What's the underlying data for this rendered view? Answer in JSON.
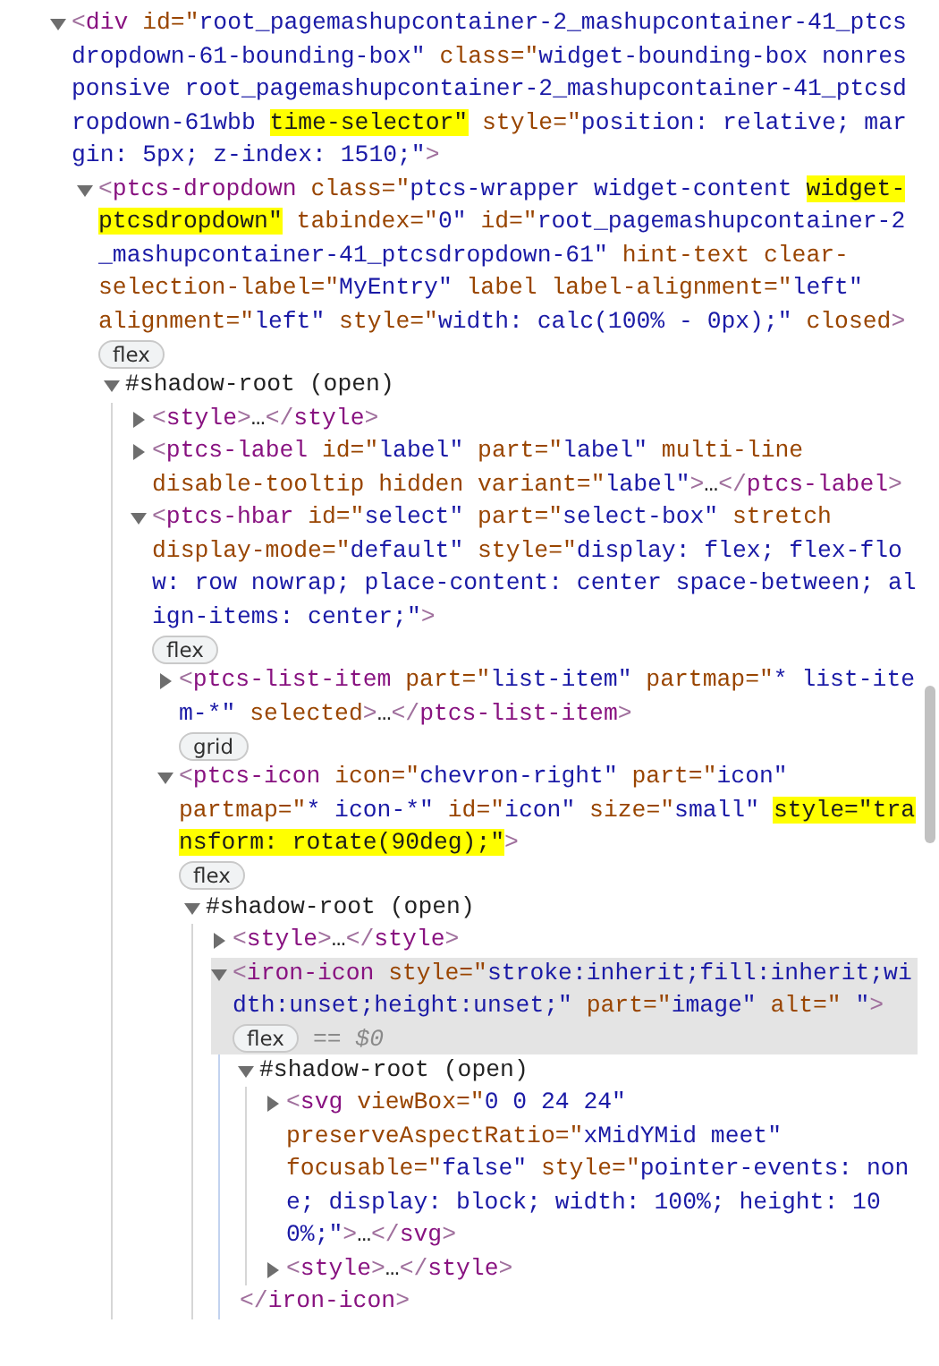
{
  "nodes": [
    {
      "kind": "element",
      "expanded": true,
      "selected": false,
      "parts": [
        {
          "kind": "punct",
          "text": "<"
        },
        {
          "kind": "tag",
          "text": "div"
        },
        {
          "kind": "attr",
          "text": " id=\""
        },
        {
          "kind": "value",
          "text": "root_pagemashupcontainer-2_mashupcontainer-41_ptcsdropdown-61-bounding-box\""
        },
        {
          "kind": "attr",
          "text": " class=\""
        },
        {
          "kind": "value",
          "text": "widget-bounding-box nonresponsive root_pagemashupcontainer-2_mashupcontainer-41_ptcsdropdown-61wbb "
        },
        {
          "kind": "mark",
          "text": "time-selector\""
        },
        {
          "kind": "attr",
          "text": " style=\""
        },
        {
          "kind": "value",
          "text": "position: relative; margin: 5px; z-index: 1510;\""
        },
        {
          "kind": "punct",
          "text": ">"
        }
      ],
      "children": [
        {
          "kind": "element",
          "expanded": true,
          "selected": false,
          "badge": "flex",
          "parts": [
            {
              "kind": "punct",
              "text": "<"
            },
            {
              "kind": "tag",
              "text": "ptcs-dropdown"
            },
            {
              "kind": "attr",
              "text": " class=\""
            },
            {
              "kind": "value",
              "text": "ptcs-wrapper widget-content "
            },
            {
              "kind": "mark",
              "text": "widget-ptcsdropdown\""
            },
            {
              "kind": "attr",
              "text": " tabindex=\""
            },
            {
              "kind": "value",
              "text": "0\""
            },
            {
              "kind": "attr",
              "text": " id=\""
            },
            {
              "kind": "value",
              "text": "root_pagemashupcontainer-2_mashupcontainer-41_ptcsdropdown-61\""
            },
            {
              "kind": "attr",
              "text": " hint-text clear-selection-label=\""
            },
            {
              "kind": "value",
              "text": "MyEntry\""
            },
            {
              "kind": "attr",
              "text": " label label-alignment=\""
            },
            {
              "kind": "value",
              "text": "left\""
            },
            {
              "kind": "attr",
              "text": " alignment=\""
            },
            {
              "kind": "value",
              "text": "left\""
            },
            {
              "kind": "attr",
              "text": " style=\""
            },
            {
              "kind": "value",
              "text": "width: calc(100% - 0px);\""
            },
            {
              "kind": "attr",
              "text": " closed"
            },
            {
              "kind": "punct",
              "text": ">"
            }
          ],
          "children": [
            {
              "kind": "shadow-root",
              "expanded": true,
              "selected": false,
              "parts": [
                {
                  "kind": "text",
                  "text": "#shadow-root (open)"
                }
              ],
              "children": [
                {
                  "kind": "element",
                  "expanded": false,
                  "selected": false,
                  "parts": [
                    {
                      "kind": "punct",
                      "text": "<"
                    },
                    {
                      "kind": "tag",
                      "text": "style"
                    },
                    {
                      "kind": "punct",
                      "text": ">"
                    },
                    {
                      "kind": "text",
                      "text": "…"
                    },
                    {
                      "kind": "punct",
                      "text": "</"
                    },
                    {
                      "kind": "tag",
                      "text": "style"
                    },
                    {
                      "kind": "punct",
                      "text": ">"
                    }
                  ]
                },
                {
                  "kind": "element",
                  "expanded": false,
                  "selected": false,
                  "parts": [
                    {
                      "kind": "punct",
                      "text": "<"
                    },
                    {
                      "kind": "tag",
                      "text": "ptcs-label"
                    },
                    {
                      "kind": "attr",
                      "text": " id=\""
                    },
                    {
                      "kind": "value",
                      "text": "label\""
                    },
                    {
                      "kind": "attr",
                      "text": " part=\""
                    },
                    {
                      "kind": "value",
                      "text": "label\""
                    },
                    {
                      "kind": "attr",
                      "text": " multi-line disable-tooltip hidden variant=\""
                    },
                    {
                      "kind": "value",
                      "text": "label\""
                    },
                    {
                      "kind": "punct",
                      "text": ">"
                    },
                    {
                      "kind": "text",
                      "text": "…"
                    },
                    {
                      "kind": "punct",
                      "text": "</"
                    },
                    {
                      "kind": "tag",
                      "text": "ptcs-label"
                    },
                    {
                      "kind": "punct",
                      "text": ">"
                    }
                  ]
                },
                {
                  "kind": "element",
                  "expanded": true,
                  "selected": false,
                  "badge": "flex",
                  "parts": [
                    {
                      "kind": "punct",
                      "text": "<"
                    },
                    {
                      "kind": "tag",
                      "text": "ptcs-hbar"
                    },
                    {
                      "kind": "attr",
                      "text": " id=\""
                    },
                    {
                      "kind": "value",
                      "text": "select\""
                    },
                    {
                      "kind": "attr",
                      "text": " part=\""
                    },
                    {
                      "kind": "value",
                      "text": "select-box\""
                    },
                    {
                      "kind": "attr",
                      "text": " stretch display-mode=\""
                    },
                    {
                      "kind": "value",
                      "text": "default\""
                    },
                    {
                      "kind": "attr",
                      "text": " style=\""
                    },
                    {
                      "kind": "value",
                      "text": "display: flex; flex-flow: row nowrap; place-content: center space-between; align-items: center;\""
                    },
                    {
                      "kind": "punct",
                      "text": ">"
                    }
                  ],
                  "children": [
                    {
                      "kind": "element",
                      "expanded": false,
                      "selected": false,
                      "badge": "grid",
                      "parts": [
                        {
                          "kind": "punct",
                          "text": "<"
                        },
                        {
                          "kind": "tag",
                          "text": "ptcs-list-item"
                        },
                        {
                          "kind": "attr",
                          "text": " part=\""
                        },
                        {
                          "kind": "value",
                          "text": "list-item\""
                        },
                        {
                          "kind": "attr",
                          "text": " partmap=\""
                        },
                        {
                          "kind": "value",
                          "text": "* list-item-*\""
                        },
                        {
                          "kind": "attr",
                          "text": " selected"
                        },
                        {
                          "kind": "punct",
                          "text": ">"
                        },
                        {
                          "kind": "text",
                          "text": "…"
                        },
                        {
                          "kind": "punct",
                          "text": "</"
                        },
                        {
                          "kind": "tag",
                          "text": "ptcs-list-item"
                        },
                        {
                          "kind": "punct",
                          "text": ">"
                        }
                      ]
                    },
                    {
                      "kind": "element",
                      "expanded": true,
                      "selected": false,
                      "badge": "flex",
                      "parts": [
                        {
                          "kind": "punct",
                          "text": "<"
                        },
                        {
                          "kind": "tag",
                          "text": "ptcs-icon"
                        },
                        {
                          "kind": "attr",
                          "text": " icon=\""
                        },
                        {
                          "kind": "value",
                          "text": "chevron-right\""
                        },
                        {
                          "kind": "attr",
                          "text": " part=\""
                        },
                        {
                          "kind": "value",
                          "text": "icon\""
                        },
                        {
                          "kind": "attr",
                          "text": " partmap=\""
                        },
                        {
                          "kind": "value",
                          "text": "* icon-*\""
                        },
                        {
                          "kind": "attr",
                          "text": " id=\""
                        },
                        {
                          "kind": "value",
                          "text": "icon\""
                        },
                        {
                          "kind": "attr",
                          "text": " size=\""
                        },
                        {
                          "kind": "value",
                          "text": "small\" "
                        },
                        {
                          "kind": "mark",
                          "text": "style=\"transform: rotate(90deg);\""
                        },
                        {
                          "kind": "punct",
                          "text": ">"
                        }
                      ],
                      "children": [
                        {
                          "kind": "shadow-root",
                          "expanded": true,
                          "selected": false,
                          "parts": [
                            {
                              "kind": "text",
                              "text": "#shadow-root (open)"
                            }
                          ],
                          "children": [
                            {
                              "kind": "element",
                              "expanded": false,
                              "selected": false,
                              "parts": [
                                {
                                  "kind": "punct",
                                  "text": "<"
                                },
                                {
                                  "kind": "tag",
                                  "text": "style"
                                },
                                {
                                  "kind": "punct",
                                  "text": ">"
                                },
                                {
                                  "kind": "text",
                                  "text": "…"
                                },
                                {
                                  "kind": "punct",
                                  "text": "</"
                                },
                                {
                                  "kind": "tag",
                                  "text": "style"
                                },
                                {
                                  "kind": "punct",
                                  "text": ">"
                                }
                              ]
                            },
                            {
                              "kind": "element",
                              "expanded": true,
                              "selected": true,
                              "badge": "flex",
                              "console_ref": "== $0",
                              "parts": [
                                {
                                  "kind": "punct",
                                  "text": "<"
                                },
                                {
                                  "kind": "tag",
                                  "text": "iron-icon"
                                },
                                {
                                  "kind": "attr",
                                  "text": " style=\""
                                },
                                {
                                  "kind": "value",
                                  "text": "stroke:inherit;fill:inherit;width:unset;height:unset;\""
                                },
                                {
                                  "kind": "attr",
                                  "text": " part=\""
                                },
                                {
                                  "kind": "value",
                                  "text": "image\""
                                },
                                {
                                  "kind": "attr",
                                  "text": " alt=\""
                                },
                                {
                                  "kind": "value",
                                  "text": " \""
                                },
                                {
                                  "kind": "punct",
                                  "text": ">"
                                }
                              ],
                              "closing": [
                                {
                                  "kind": "punct",
                                  "text": "</"
                                },
                                {
                                  "kind": "tag",
                                  "text": "iron-icon"
                                },
                                {
                                  "kind": "punct",
                                  "text": ">"
                                }
                              ],
                              "children": [
                                {
                                  "kind": "shadow-root",
                                  "expanded": true,
                                  "selected": false,
                                  "parts": [
                                    {
                                      "kind": "text",
                                      "text": "#shadow-root (open)"
                                    }
                                  ],
                                  "children": [
                                    {
                                      "kind": "element",
                                      "expanded": false,
                                      "selected": false,
                                      "parts": [
                                        {
                                          "kind": "punct",
                                          "text": "<"
                                        },
                                        {
                                          "kind": "tag",
                                          "text": "svg"
                                        },
                                        {
                                          "kind": "attr",
                                          "text": " viewBox=\""
                                        },
                                        {
                                          "kind": "value",
                                          "text": "0 0 24 24\""
                                        },
                                        {
                                          "kind": "attr",
                                          "text": " preserveAspectRatio=\""
                                        },
                                        {
                                          "kind": "value",
                                          "text": "xMidYMid meet\""
                                        },
                                        {
                                          "kind": "attr",
                                          "text": " focusable=\""
                                        },
                                        {
                                          "kind": "value",
                                          "text": "false\""
                                        },
                                        {
                                          "kind": "attr",
                                          "text": " style=\""
                                        },
                                        {
                                          "kind": "value",
                                          "text": "pointer-events: none; display: block; width: 100%; height: 100%;\""
                                        },
                                        {
                                          "kind": "punct",
                                          "text": ">"
                                        },
                                        {
                                          "kind": "text",
                                          "text": "…"
                                        },
                                        {
                                          "kind": "punct",
                                          "text": "</"
                                        },
                                        {
                                          "kind": "tag",
                                          "text": "svg"
                                        },
                                        {
                                          "kind": "punct",
                                          "text": ">"
                                        }
                                      ]
                                    },
                                    {
                                      "kind": "element",
                                      "expanded": false,
                                      "selected": false,
                                      "parts": [
                                        {
                                          "kind": "punct",
                                          "text": "<"
                                        },
                                        {
                                          "kind": "tag",
                                          "text": "style"
                                        },
                                        {
                                          "kind": "punct",
                                          "text": ">"
                                        },
                                        {
                                          "kind": "text",
                                          "text": "…"
                                        },
                                        {
                                          "kind": "punct",
                                          "text": "</"
                                        },
                                        {
                                          "kind": "tag",
                                          "text": "style"
                                        },
                                        {
                                          "kind": "punct",
                                          "text": ">"
                                        }
                                      ]
                                    }
                                  ]
                                }
                              ]
                            }
                          ]
                        }
                      ]
                    }
                  ]
                }
              ]
            }
          ]
        }
      ]
    }
  ]
}
